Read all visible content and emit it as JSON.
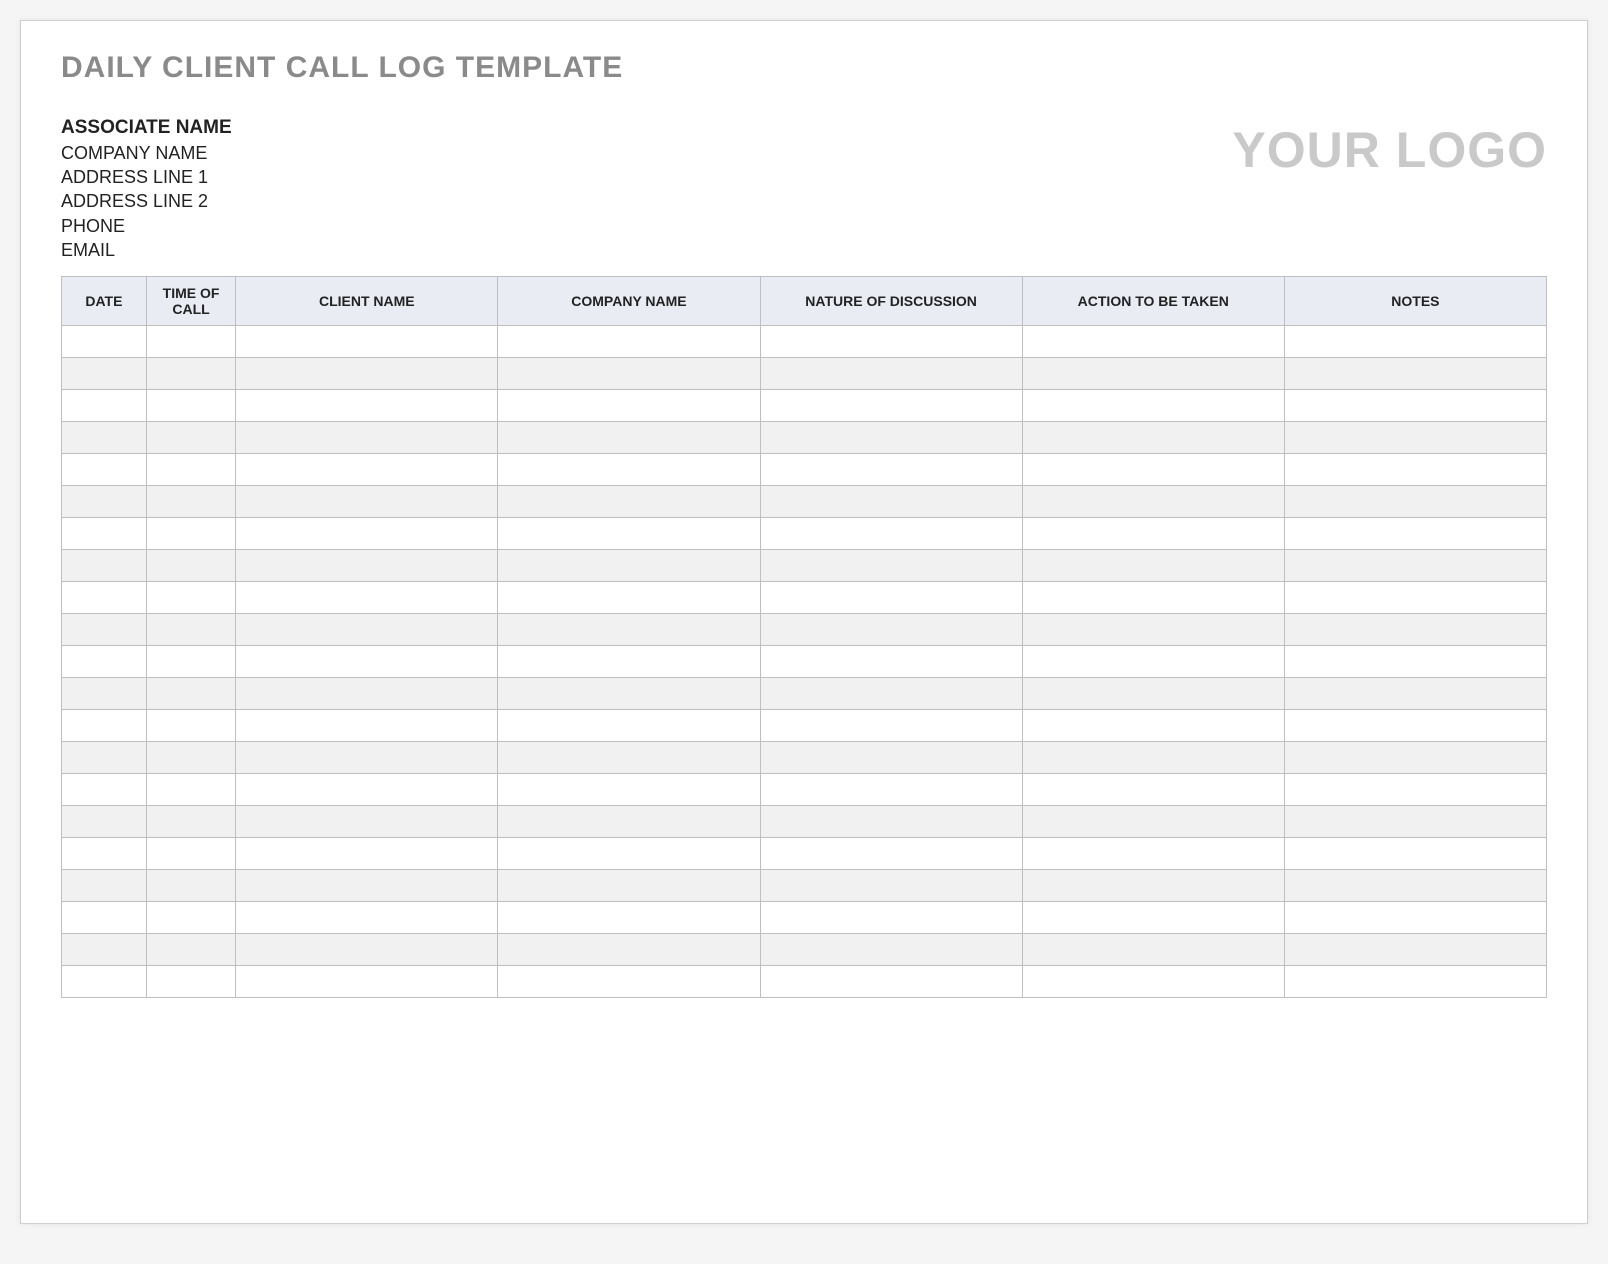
{
  "title": "DAILY CLIENT CALL LOG TEMPLATE",
  "associate": {
    "name": "ASSOCIATE NAME",
    "company": "COMPANY NAME",
    "address1": "ADDRESS LINE 1",
    "address2": "ADDRESS LINE 2",
    "phone": "PHONE",
    "email": "EMAIL"
  },
  "logo_text": "YOUR LOGO",
  "columns": {
    "date": "DATE",
    "time": "TIME OF CALL",
    "client": "CLIENT NAME",
    "company": "COMPANY NAME",
    "nature": "NATURE OF DISCUSSION",
    "action": "ACTION TO BE TAKEN",
    "notes": "NOTES"
  },
  "row_count": 21
}
